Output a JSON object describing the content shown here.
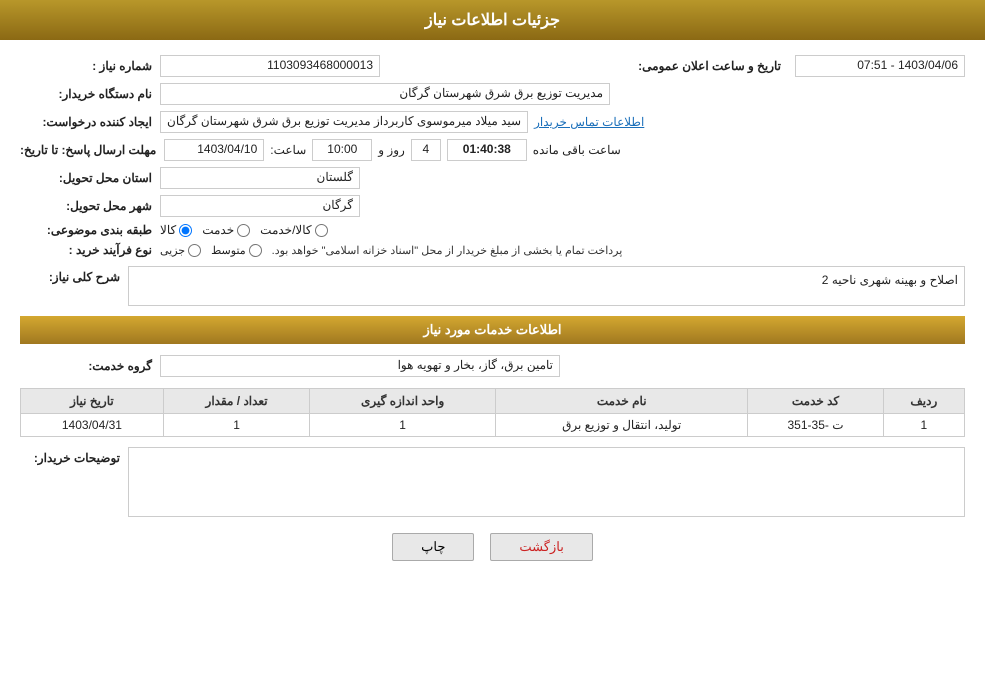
{
  "header": {
    "title": "جزئیات اطلاعات نیاز"
  },
  "fields": {
    "shomare_niaz_label": "شماره نیاز :",
    "shomare_niaz_value": "1103093468000013",
    "tarikh_label": "تاریخ و ساعت اعلان عمومی:",
    "tarikh_value": "1403/04/06 - 07:51",
    "naam_dastgah_label": "نام دستگاه خریدار:",
    "naam_dastgah_value": "مدیریت توزیع برق شرق شهرستان گرگان",
    "ijad_konande_label": "ایجاد کننده درخواست:",
    "ijad_konande_value": "سید میلاد میرموسوی کاربرداز مدیریت توزیع برق شرق شهرستان گرگان",
    "contact_link": "اطلاعات تماس خریدار",
    "mohlat_label": "مهلت ارسال پاسخ: تا تاریخ:",
    "mohlat_date": "1403/04/10",
    "mohlat_time_label": "ساعت:",
    "mohlat_time": "10:00",
    "mohlat_days_label": "روز و",
    "mohlat_days": "4",
    "mohlat_countdown_label": "ساعت باقی مانده",
    "mohlat_countdown": "01:40:38",
    "ostan_label": "استان محل تحویل:",
    "ostan_value": "گلستان",
    "shahr_label": "شهر محل تحویل:",
    "shahr_value": "گرگان",
    "tabaqebandi_label": "طبقه بندی موضوعی:",
    "tabaqe_options": [
      "کالا",
      "خدمت",
      "کالا/خدمت"
    ],
    "tabaqe_selected": "کالا",
    "noe_farayand_label": "نوع فرآیند خرید :",
    "farayand_options": [
      "جزیی",
      "متوسط"
    ],
    "farayand_note": "پرداخت تمام یا بخشی از مبلغ خریدار از محل \"اسناد خزانه اسلامی\" خواهد بود.",
    "sharh_label": "شرح کلی نیاز:",
    "sharh_value": "اصلاح و بهینه  شهری ناحیه 2",
    "services_section_title": "اطلاعات خدمات مورد نیاز",
    "grohe_khadamat_label": "گروه خدمت:",
    "grohe_khadamat_value": "تامین برق، گاز، بخار و تهویه هوا",
    "table": {
      "columns": [
        "ردیف",
        "کد خدمت",
        "نام خدمت",
        "واحد اندازه گیری",
        "تعداد / مقدار",
        "تاریخ نیاز"
      ],
      "rows": [
        {
          "radif": "1",
          "kod": "ت -35-351",
          "naam": "تولید، انتقال و توزیع برق",
          "vahed": "1",
          "tedad": "1",
          "tarikh": "1403/04/31"
        }
      ]
    },
    "buyer_desc_label": "توضیحات خریدار:",
    "buyer_desc_value": ""
  },
  "buttons": {
    "print": "چاپ",
    "back": "بازگشت"
  }
}
